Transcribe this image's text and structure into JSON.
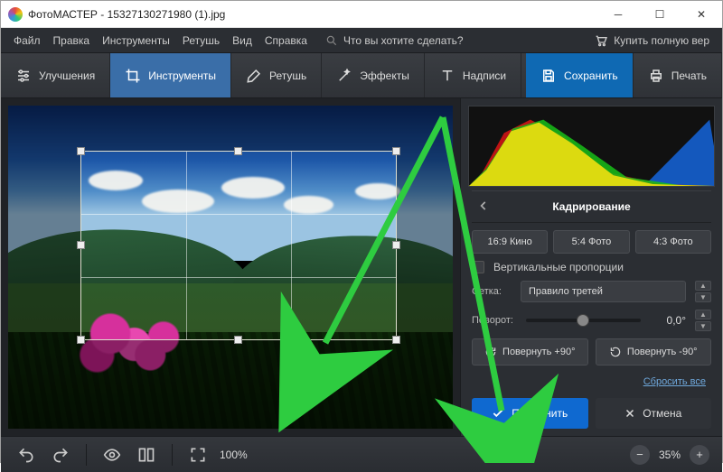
{
  "window": {
    "title": "ФотоМАСТЕР - 15327130271980 (1).jpg"
  },
  "menu": {
    "file": "Файл",
    "edit": "Правка",
    "tools": "Инструменты",
    "retouch": "Ретушь",
    "view": "Вид",
    "help": "Справка",
    "search_placeholder": "Что вы хотите сделать?",
    "buy": "Купить полную вер"
  },
  "toolbar": {
    "enhance": "Улучшения",
    "tools": "Инструменты",
    "retouch": "Ретушь",
    "effects": "Эффекты",
    "captions": "Надписи",
    "save": "Сохранить",
    "print": "Печать"
  },
  "crop_panel": {
    "title": "Кадрирование",
    "presets": {
      "a": "16:9 Кино",
      "b": "5:4 Фото",
      "c": "4:3 Фото"
    },
    "vertical_prop": "Вертикальные пропорции",
    "grid_label": "Сетка:",
    "grid_value": "Правило третей",
    "rotate_label": "Поворот:",
    "rotate_value": "0,0°",
    "rotcw": "Повернуть +90°",
    "rotccw": "Повернуть -90°",
    "reset": "Сбросить все",
    "apply": "Применить",
    "cancel": "Отмена"
  },
  "bottom": {
    "zoom_fit": "100%",
    "zoom_cur": "35%"
  }
}
